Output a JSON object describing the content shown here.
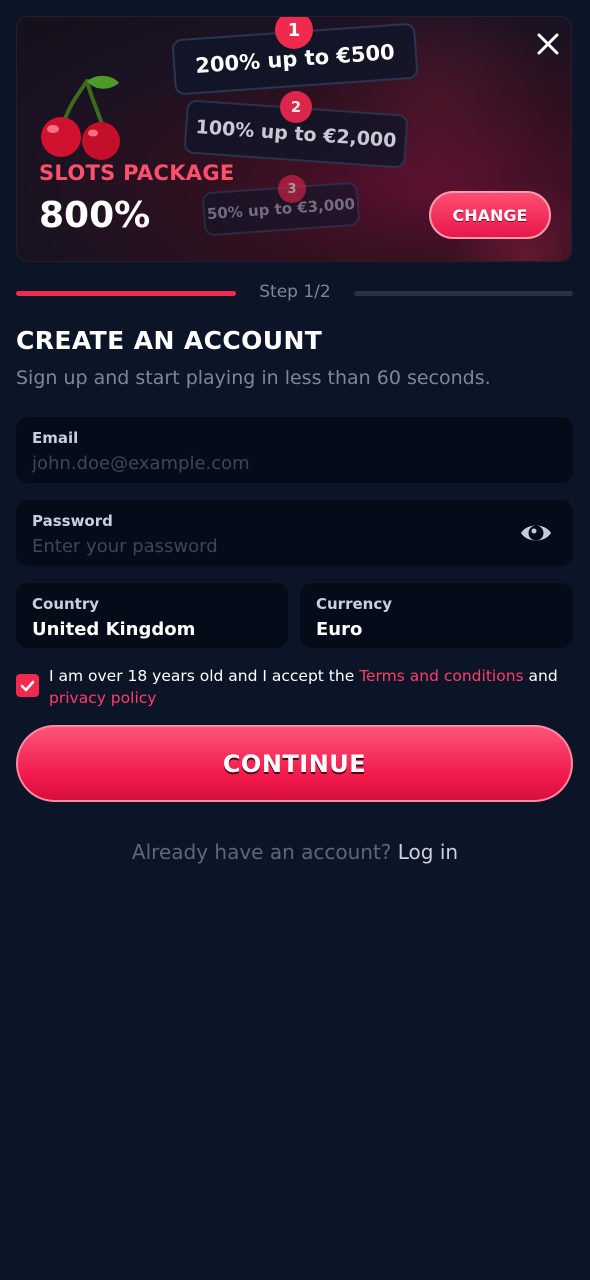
{
  "banner": {
    "package_label": "SLOTS PACKAGE",
    "package_percent": "800%",
    "tiers": [
      {
        "badge": "1",
        "text": "200% up to €500"
      },
      {
        "badge": "2",
        "text": "100% up to €2,000"
      },
      {
        "badge": "3",
        "text": "50% up to €3,000"
      }
    ],
    "change_label": "CHANGE"
  },
  "stepper": {
    "text": "Step 1/2",
    "progress_fraction": 0.5
  },
  "form": {
    "title": "CREATE AN ACCOUNT",
    "subtitle": "Sign up and start playing in less than 60 seconds.",
    "email": {
      "label": "Email",
      "placeholder": "john.doe@example.com"
    },
    "password": {
      "label": "Password",
      "placeholder": "Enter your password"
    },
    "country": {
      "label": "Country",
      "value": "United Kingdom"
    },
    "currency": {
      "label": "Currency",
      "value": "Euro"
    },
    "terms": {
      "checked": true,
      "prefix": "I am over 18 years old and I accept the ",
      "terms_link": "Terms and conditions",
      "middle": " and ",
      "privacy_link": "privacy policy"
    },
    "continue_label": "CONTINUE",
    "login_prompt": "Already have an account? ",
    "login_link": "Log in"
  },
  "colors": {
    "background": "#0c1528",
    "accent": "#f0294f",
    "field_bg": "#050b18"
  },
  "icons": [
    "cherry-icon",
    "close-icon",
    "eye-icon",
    "check-icon"
  ]
}
